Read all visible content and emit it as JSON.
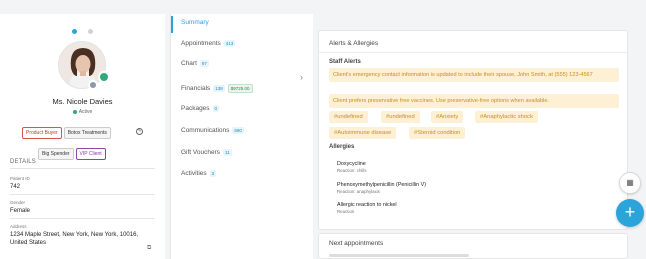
{
  "profile": {
    "name": "Ms. Nicole Davies",
    "status": "Active",
    "tags": [
      "Product Buyer",
      "Botox Treatments",
      "Big Spender",
      "VIP Client"
    ],
    "details_heading": "DETAILS",
    "patient_id_label": "Patient ID",
    "patient_id": "742",
    "gender_label": "Gender",
    "gender": "Female",
    "address_label": "Address",
    "address": "1234 Maple Street, New York, New York, 10016, United States",
    "colors": {
      "accent": "#2aa4d9",
      "status": "#2fa97b"
    }
  },
  "nav": {
    "items": [
      {
        "label": "Summary",
        "count": ""
      },
      {
        "label": "Appointments",
        "count": "413"
      },
      {
        "label": "Chart",
        "count": "97"
      },
      {
        "label": "Financials",
        "count": "138",
        "amount": "$9725.00"
      },
      {
        "label": "Packages",
        "count": "0"
      },
      {
        "label": "Communications",
        "count": "690"
      },
      {
        "label": "Gift Vouchers",
        "count": "11"
      },
      {
        "label": "Activities",
        "count": "3"
      }
    ]
  },
  "alerts_card": {
    "title": "Alerts & Allergies",
    "staff_alerts_heading": "Staff Alerts",
    "alerts": [
      "Client's emergency contact information is updated to include their spouse, John Smith, at (555) 123-4567",
      "Client prefers preservative free vaccines. Use preservative-free options when available."
    ],
    "hashtags": [
      "#undefined",
      "#undefined",
      "#Anxiety",
      "#Anaphylactic shock",
      "#Autoimmune disease",
      "#Steroid condition"
    ],
    "allergies_heading": "Allergies",
    "allergies": [
      {
        "name": "Doxycycline",
        "reaction": "Reaction: chills"
      },
      {
        "name": "Phenoxymethylpenicillin (Penicillin V)",
        "reaction": "Reaction: anaphylaxis"
      },
      {
        "name": "Allergic reaction to nickel",
        "reaction": "Reaction"
      }
    ]
  },
  "next_card": {
    "title": "Next appointments"
  },
  "icons": {
    "calendar": "calendar-icon",
    "add": "plus-icon",
    "copy": "copy-icon",
    "edit": "edit-icon",
    "chevron": "chevron-right-icon"
  }
}
